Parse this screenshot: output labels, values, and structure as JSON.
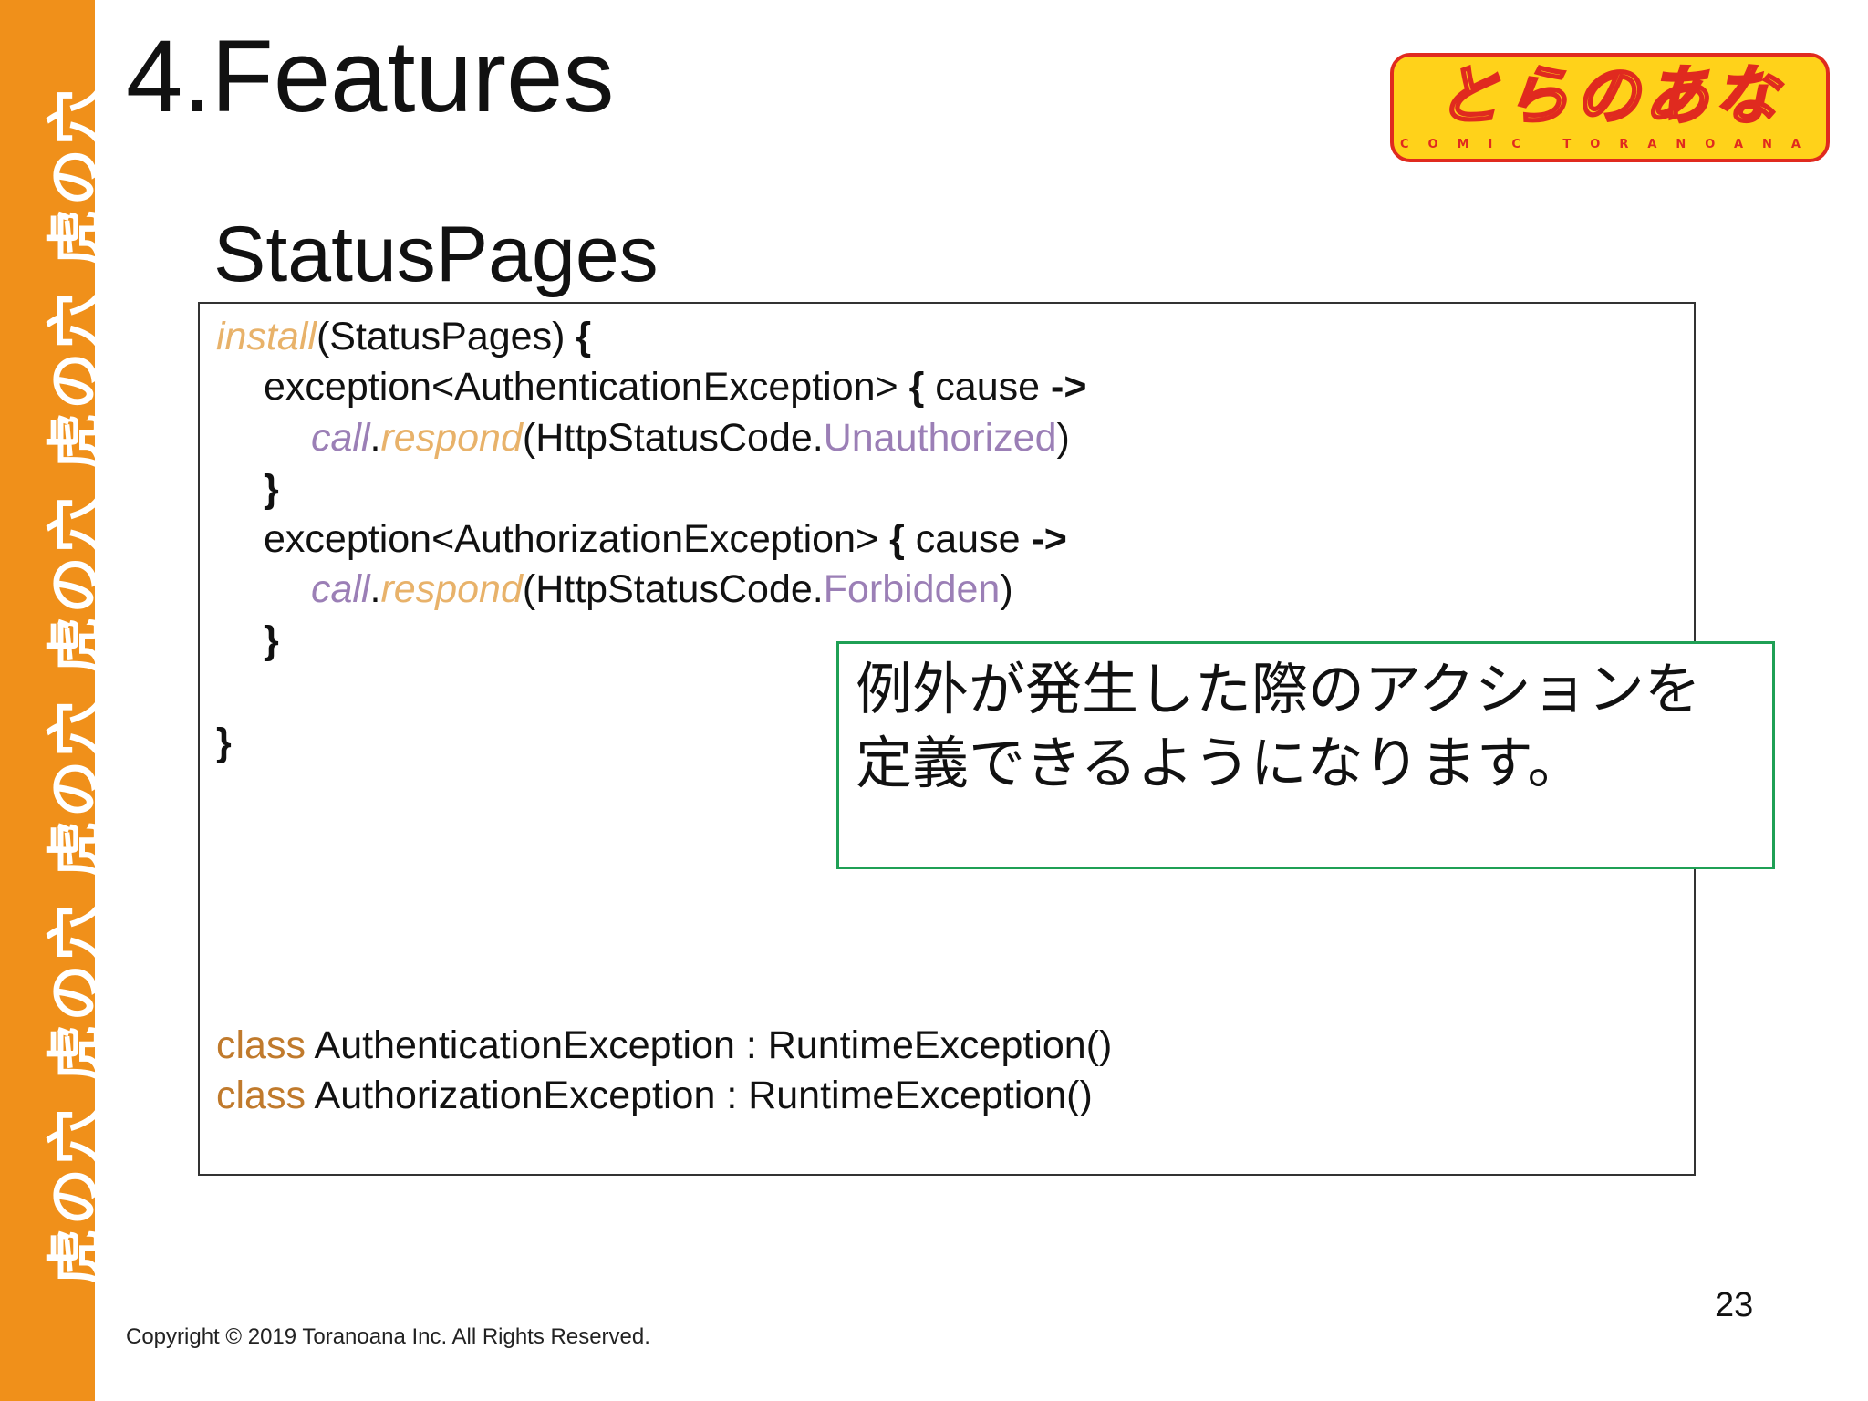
{
  "sidebar": {
    "text": "虎の穴 虎の穴 虎の穴 虎の穴 虎の穴 虎の穴"
  },
  "slide": {
    "title": "4.Features",
    "section_title": "StatusPages",
    "page_number": "23",
    "copyright": "Copyright © 2019 Toranoana Inc. All Rights Reserved."
  },
  "logo": {
    "main": "とらのあな",
    "sub": "COMIC TORANOANA"
  },
  "code": {
    "l1_fn": "install",
    "l1_arg": "(StatusPages) ",
    "l1_brace": "{",
    "l2_text": "exception<AuthenticationException> ",
    "l2_brace": "{",
    "l2_cause": " cause ",
    "l2_arrow": "->",
    "l3_call": "call",
    "l3_dot": ".",
    "l3_respond": "respond",
    "l3_arg": "(HttpStatusCode.",
    "l3_const": "Unauthorized",
    "l3_close": ")",
    "l4_brace": "}",
    "l5_text": "exception<AuthorizationException> ",
    "l5_brace": "{",
    "l5_cause": " cause ",
    "l5_arrow": "->",
    "l6_call": "call",
    "l6_dot": ".",
    "l6_respond": "respond",
    "l6_arg": "(HttpStatusCode.",
    "l6_const": "Forbidden",
    "l6_close": ")",
    "l7_brace": "}",
    "l8_brace": "}",
    "c1_kw": "class",
    "c1_rest": " AuthenticationException : RuntimeException()",
    "c2_kw": "class",
    "c2_rest": " AuthorizationException : RuntimeException()"
  },
  "note": {
    "line1": "例外が発生した際のアクションを",
    "line2": "定義できるようになります。"
  },
  "colors": {
    "sidebar": "#f0901a",
    "function": "#e8b26a",
    "call": "#9b7fb6",
    "class_keyword": "#c07a2c",
    "note_border": "#1fa055",
    "logo_bg": "#ffd21a",
    "logo_accent": "#e02a1f"
  }
}
